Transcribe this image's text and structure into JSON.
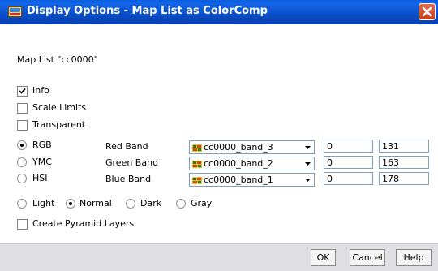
{
  "window": {
    "title": "Display Options - Map List as ColorComp"
  },
  "dialog": {
    "map_list_label": "Map List \"cc0000\"",
    "checkboxes": {
      "info": {
        "label": "Info",
        "checked": true
      },
      "scale_limits": {
        "label": "Scale Limits",
        "checked": false
      },
      "transparent": {
        "label": "Transparent",
        "checked": false
      },
      "pyramid": {
        "label": "Create Pyramid Layers",
        "checked": false
      }
    },
    "color_model": {
      "options": [
        "RGB",
        "YMC",
        "HSI"
      ],
      "selected": "RGB"
    },
    "bands": [
      {
        "label": "Red Band",
        "value": "cc0000_band_3",
        "min": "0",
        "max": "131"
      },
      {
        "label": "Green Band",
        "value": "cc0000_band_2",
        "min": "0",
        "max": "163"
      },
      {
        "label": "Blue Band",
        "value": "cc0000_band_1",
        "min": "0",
        "max": "178"
      }
    ],
    "stretch": {
      "options": [
        "Light",
        "Normal",
        "Dark",
        "Gray"
      ],
      "selected": "Normal"
    }
  },
  "footer": {
    "ok": "OK",
    "cancel": "Cancel",
    "help": "Help"
  },
  "colors": {
    "titlebar": "#0a4ec8",
    "close": "#d2502e",
    "footer": "#e0dfe3"
  }
}
